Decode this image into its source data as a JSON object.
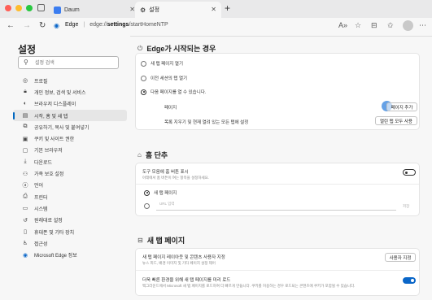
{
  "colors": {
    "accent": "#0a66c8",
    "selected_bar": "#0067c0",
    "lights": [
      "#ff5f57",
      "#febc2e",
      "#28c840"
    ]
  },
  "tabs": [
    {
      "label": "Daum",
      "icon": "daum-favicon"
    },
    {
      "label": "설정",
      "icon": "gear-icon"
    }
  ],
  "address": {
    "brand": "Edge",
    "url_prefix": "edge://",
    "url_bold": "settings",
    "url_suffix": "/startHomeNTP"
  },
  "sidebar": {
    "title": "설정",
    "search_placeholder": "설정 검색",
    "items": [
      {
        "label": "프로필",
        "icon": "profile-icon"
      },
      {
        "label": "개인 정보, 검색 및 서비스",
        "icon": "lock-icon"
      },
      {
        "label": "브라우저 디스플레이",
        "icon": "display-icon"
      },
      {
        "label": "시작, 홈 및 새 탭",
        "icon": "home-tabs-icon",
        "selected": true
      },
      {
        "label": "공유하기, 복사 및 붙여넣기",
        "icon": "share-icon"
      },
      {
        "label": "쿠키 및 사이트 권한",
        "icon": "cookie-icon"
      },
      {
        "label": "기본 브라우저",
        "icon": "browser-icon"
      },
      {
        "label": "다운로드",
        "icon": "download-icon"
      },
      {
        "label": "가족 보호 설정",
        "icon": "family-icon"
      },
      {
        "label": "언어",
        "icon": "language-icon"
      },
      {
        "label": "프린터",
        "icon": "printer-icon"
      },
      {
        "label": "시스템",
        "icon": "system-icon"
      },
      {
        "label": "원래대로 설정",
        "icon": "reset-icon"
      },
      {
        "label": "휴대폰 및 기타 장치",
        "icon": "phone-icon"
      },
      {
        "label": "접근성",
        "icon": "accessibility-icon"
      },
      {
        "label": "Microsoft Edge 정보",
        "icon": "edge-icon"
      }
    ]
  },
  "startup": {
    "title": "Edge가 시작되는 경우",
    "options": [
      "새 탭 페이지 열기",
      "이전 세션의 탭 열기",
      "다음 페이지를 열 수 있습니다."
    ],
    "selected_index": 2,
    "pages_label": "페이지",
    "add_page_button": "페이지 추가",
    "use_open_tabs_label": "목록 지우기 및 현재 열려 있는 모든 탭에 설정",
    "use_all_tabs_button": "열린 탭 모두 사용"
  },
  "home": {
    "title": "홈 단추",
    "toolbar_label": "도구 모음에 홈 버튼 표시",
    "toolbar_desc": "아래에서 홈 버튼이 여는 항목을 설정하세요.",
    "toggle_on": false,
    "newtab_option": "새 탭 페이지",
    "url_placeholder": "URL 입력",
    "save_button": "저장"
  },
  "newtab": {
    "title": "새 탭 페이지",
    "customize_label": "새 탭 페이지 레이아웃 및 콘텐츠 사용자 지정",
    "customize_desc": "뉴스 피드, 배경 이미지 및 기타 페이지 설정 제어",
    "customize_button": "사용자 지정",
    "preload_label": "더욱 빠른 환경을 위해 새 탭 페이지를 미리 로드",
    "preload_desc": "백그라운드에서 Microsoft 새 탭 페이지를 로드하여 더 빠르게 만듭니다. 쿠키를 허용하는 경우 로드되는 콘텐츠에 쿠키가 포함될 수 있습니다.",
    "toggle_on": true
  }
}
